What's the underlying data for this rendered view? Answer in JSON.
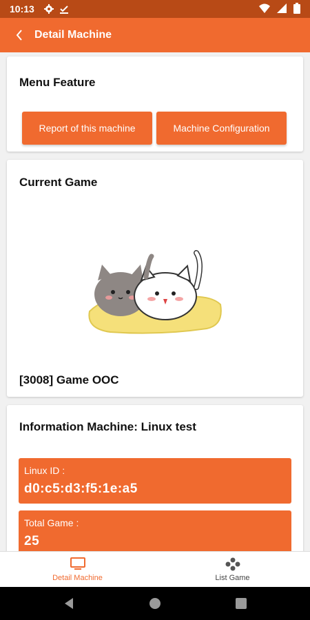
{
  "status_bar": {
    "time": "10:13"
  },
  "app_bar": {
    "title": "Detail Machine"
  },
  "menu": {
    "title": "Menu Feature",
    "report_button": "Report of this machine",
    "config_button": "Machine Configuration"
  },
  "current_game": {
    "title": "Current Game",
    "name": "[3008] Game OOC"
  },
  "info": {
    "title": "Information Machine: Linux test",
    "linux_id_label": "Linux ID :",
    "linux_id_value": "d0:c5:d3:f5:1e:a5",
    "total_game_label": "Total Game :",
    "total_game_value": "25"
  },
  "bottom_nav": {
    "items": [
      {
        "label": "Detail Machine",
        "icon": "monitor-icon",
        "active": true
      },
      {
        "label": "List Game",
        "icon": "gamepad-icon",
        "active": false
      }
    ]
  },
  "colors": {
    "accent": "#f06a2f",
    "status_bar": "#b84a16"
  }
}
